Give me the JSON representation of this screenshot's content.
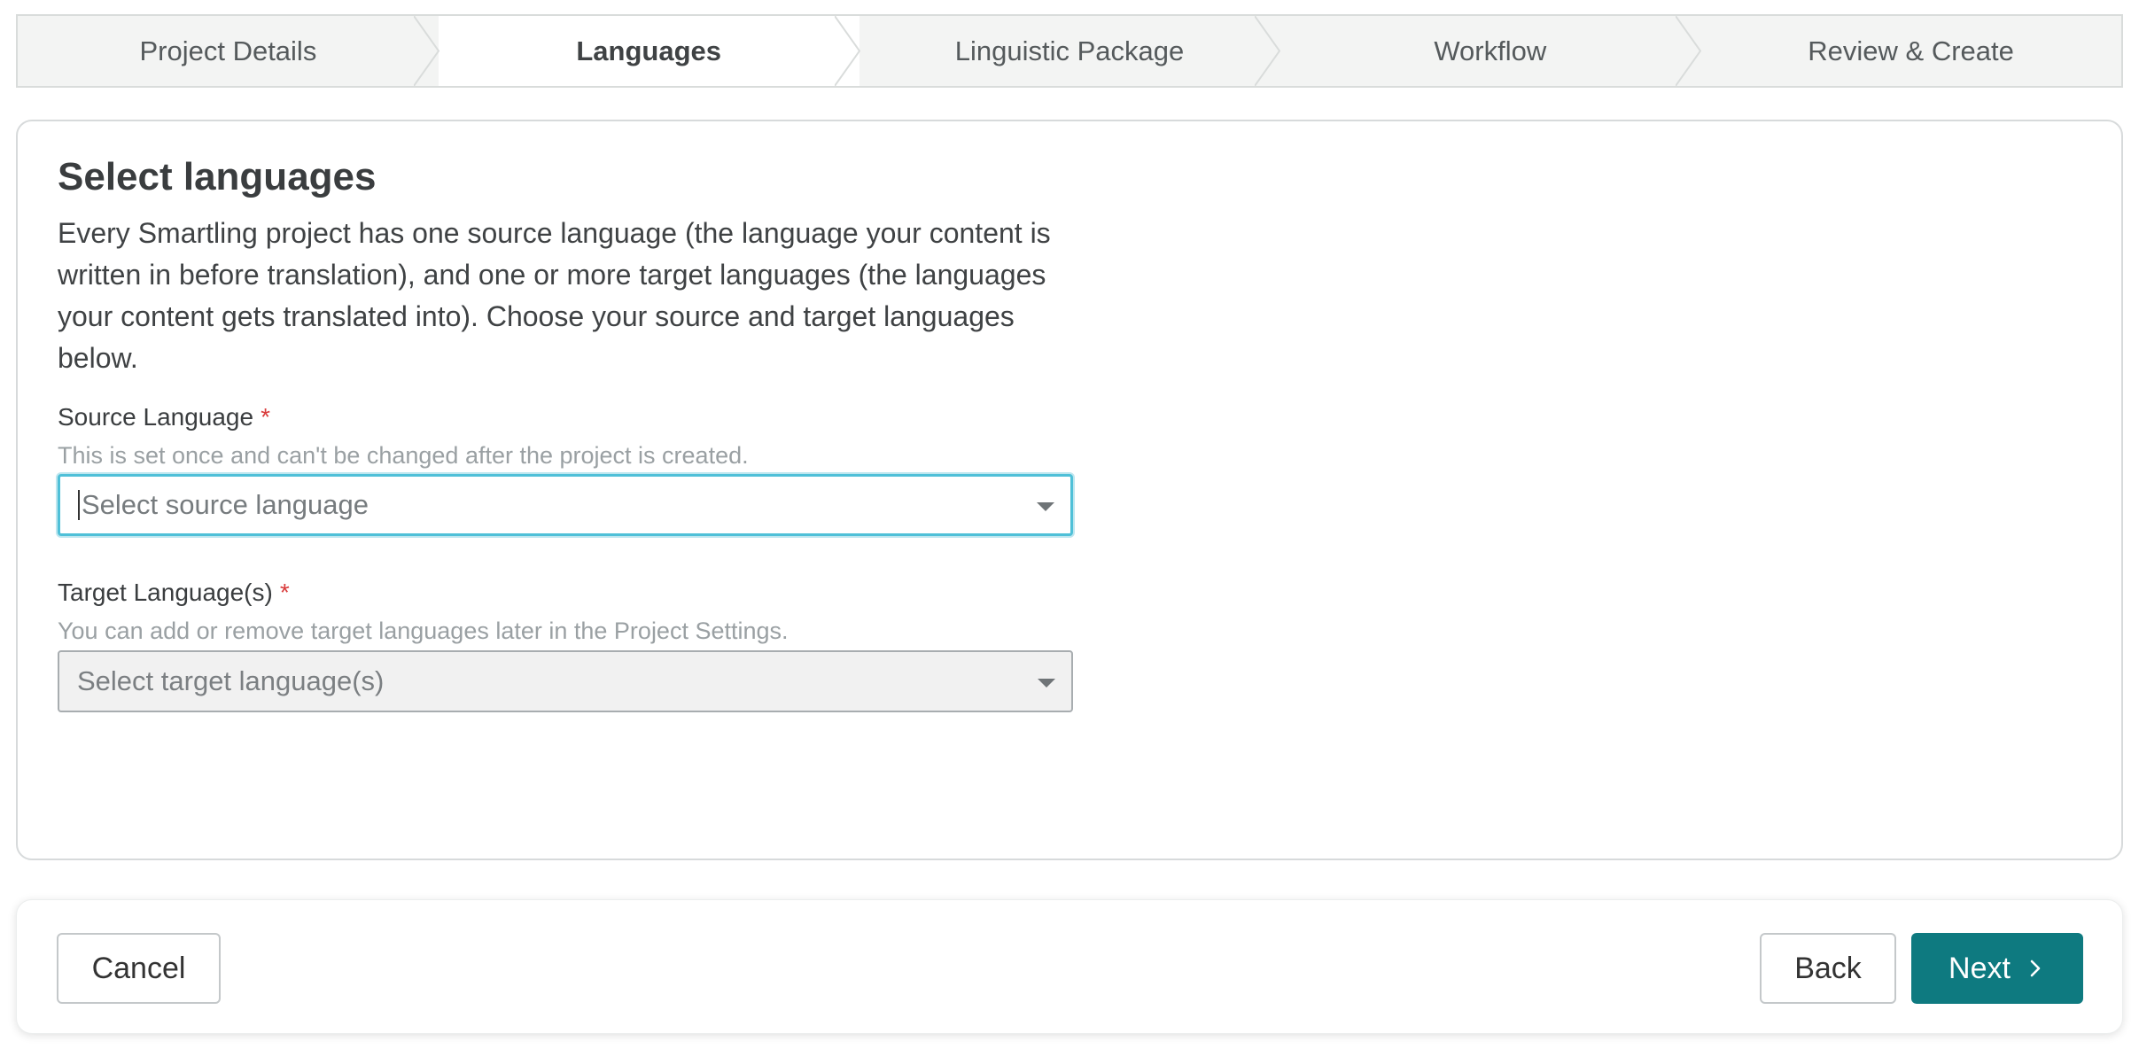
{
  "stepper": {
    "steps": [
      {
        "label": "Project Details",
        "active": false
      },
      {
        "label": "Languages",
        "active": true
      },
      {
        "label": "Linguistic Package",
        "active": false
      },
      {
        "label": "Workflow",
        "active": false
      },
      {
        "label": "Review & Create",
        "active": false
      }
    ]
  },
  "main": {
    "title": "Select languages",
    "description": "Every Smartling project has one source language (the language your content is written in before translation), and one or more target languages (the languages your content gets translated into). Choose your source and target languages below.",
    "source": {
      "label": "Source Language",
      "required_mark": "*",
      "help": "This is set once and can't be changed after the project is created.",
      "placeholder": "Select source language"
    },
    "target": {
      "label": "Target Language(s)",
      "required_mark": "*",
      "help": "You can add or remove target languages later in the Project Settings.",
      "placeholder": "Select target language(s)"
    }
  },
  "footer": {
    "cancel_label": "Cancel",
    "back_label": "Back",
    "next_label": "Next"
  },
  "colors": {
    "accent": "#0e7a80",
    "focus_ring": "#4fc0d8",
    "required": "#d93b3b"
  },
  "icons": {
    "dropdown": "chevron-down-icon",
    "next": "chevron-right-icon"
  }
}
